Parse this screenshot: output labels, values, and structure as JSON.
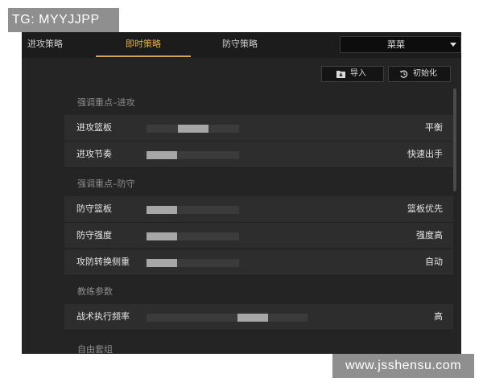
{
  "watermark_top": "TG: MYYJJPP",
  "watermark_bottom": "www.jsshensu.com",
  "tabs": [
    {
      "label": "进攻策略"
    },
    {
      "label": "即时策略"
    },
    {
      "label": "防守策略"
    }
  ],
  "dropdown": {
    "selected": "菜菜"
  },
  "buttons": {
    "import": "导入",
    "reset": "初始化"
  },
  "sections": [
    {
      "title": "强调重点–进攻"
    },
    {
      "title": "强调重点–防守"
    },
    {
      "title": "教练参数"
    },
    {
      "title": "自由套组"
    }
  ],
  "rows": [
    {
      "name": "进攻篮板",
      "value": "平衡",
      "level": 0.5
    },
    {
      "name": "进攻节奏",
      "value": "快速出手",
      "level": 0.0
    },
    {
      "name": "防守篮板",
      "value": "篮板优先",
      "level": 0.0
    },
    {
      "name": "防守强度",
      "value": "强度高",
      "level": 0.0
    },
    {
      "name": "攻防转换侧重",
      "value": "自动",
      "level": 0.0
    },
    {
      "name": "战术执行频率",
      "value": "高",
      "level": 0.7
    }
  ],
  "colors": {
    "accent": "#d9a63b",
    "panel": "#242425",
    "row": "#2d2d2e"
  }
}
